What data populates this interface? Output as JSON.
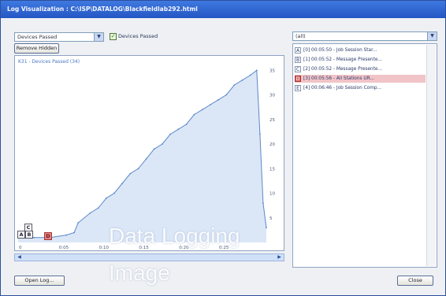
{
  "window": {
    "title": "Log Visualization : C:\\ISP\\DATALOG\\Blackfieldlab292.html"
  },
  "toolbar": {
    "metric_select": "Devices Passed",
    "checkbox_label": "Devices Passed",
    "checkbox_checked": true,
    "remove_hidden_label": "Remove Hidden"
  },
  "chart_data": {
    "type": "area",
    "series_label": "K31 - Devices Passed (34)",
    "x_tick_labels": [
      "0",
      "0:05",
      "0:10",
      "0:15",
      "0:20",
      "0:25"
    ],
    "y_tick_labels": [
      "5",
      "10",
      "15",
      "20",
      "25",
      "30",
      "35"
    ],
    "x": [
      0,
      2,
      4,
      6,
      7,
      7.5,
      9,
      10,
      11,
      12,
      13,
      14,
      15,
      16,
      17,
      18,
      19,
      20,
      21,
      22,
      23,
      24,
      25,
      26,
      27,
      28,
      29,
      29.8,
      30.2,
      30.6,
      31
    ],
    "y": [
      1,
      1,
      1,
      1.5,
      2,
      4,
      6,
      7,
      9,
      10,
      12,
      14,
      15,
      17,
      19,
      20,
      22,
      23,
      24,
      26,
      27,
      28,
      29,
      30,
      32,
      33,
      34,
      35,
      22,
      8,
      3
    ],
    "xlim": [
      0,
      31
    ],
    "ylim": [
      0,
      36
    ],
    "fill_color": "#dbe7f7",
    "line_color": "#5b87c8"
  },
  "markers": [
    {
      "letter": "C",
      "color": "#ffffff"
    },
    {
      "letter": "A",
      "color": "#ffffff"
    },
    {
      "letter": "B",
      "color": "#ffffff"
    },
    {
      "letter": "D",
      "color": "#d88888"
    }
  ],
  "filter_select": "(all)",
  "log_entries": [
    {
      "key": "A",
      "text": "[0] 00:05:50 - Job Session Star...",
      "selected": false
    },
    {
      "key": "B",
      "text": "[1] 00:05:52 - Message Presente...",
      "selected": false
    },
    {
      "key": "C",
      "text": "[2] 00:05:52 - Message Presente...",
      "selected": false
    },
    {
      "key": "D",
      "text": "[3] 00:05:56 - All Stations UR...",
      "selected": true
    },
    {
      "key": "E",
      "text": "[4] 00:06:46 - Job Session Comp...",
      "selected": false
    }
  ],
  "buttons": {
    "open_log": "Open Log...",
    "close": "Close"
  },
  "watermark": {
    "line1": "Data Logging",
    "line2": "Image"
  }
}
